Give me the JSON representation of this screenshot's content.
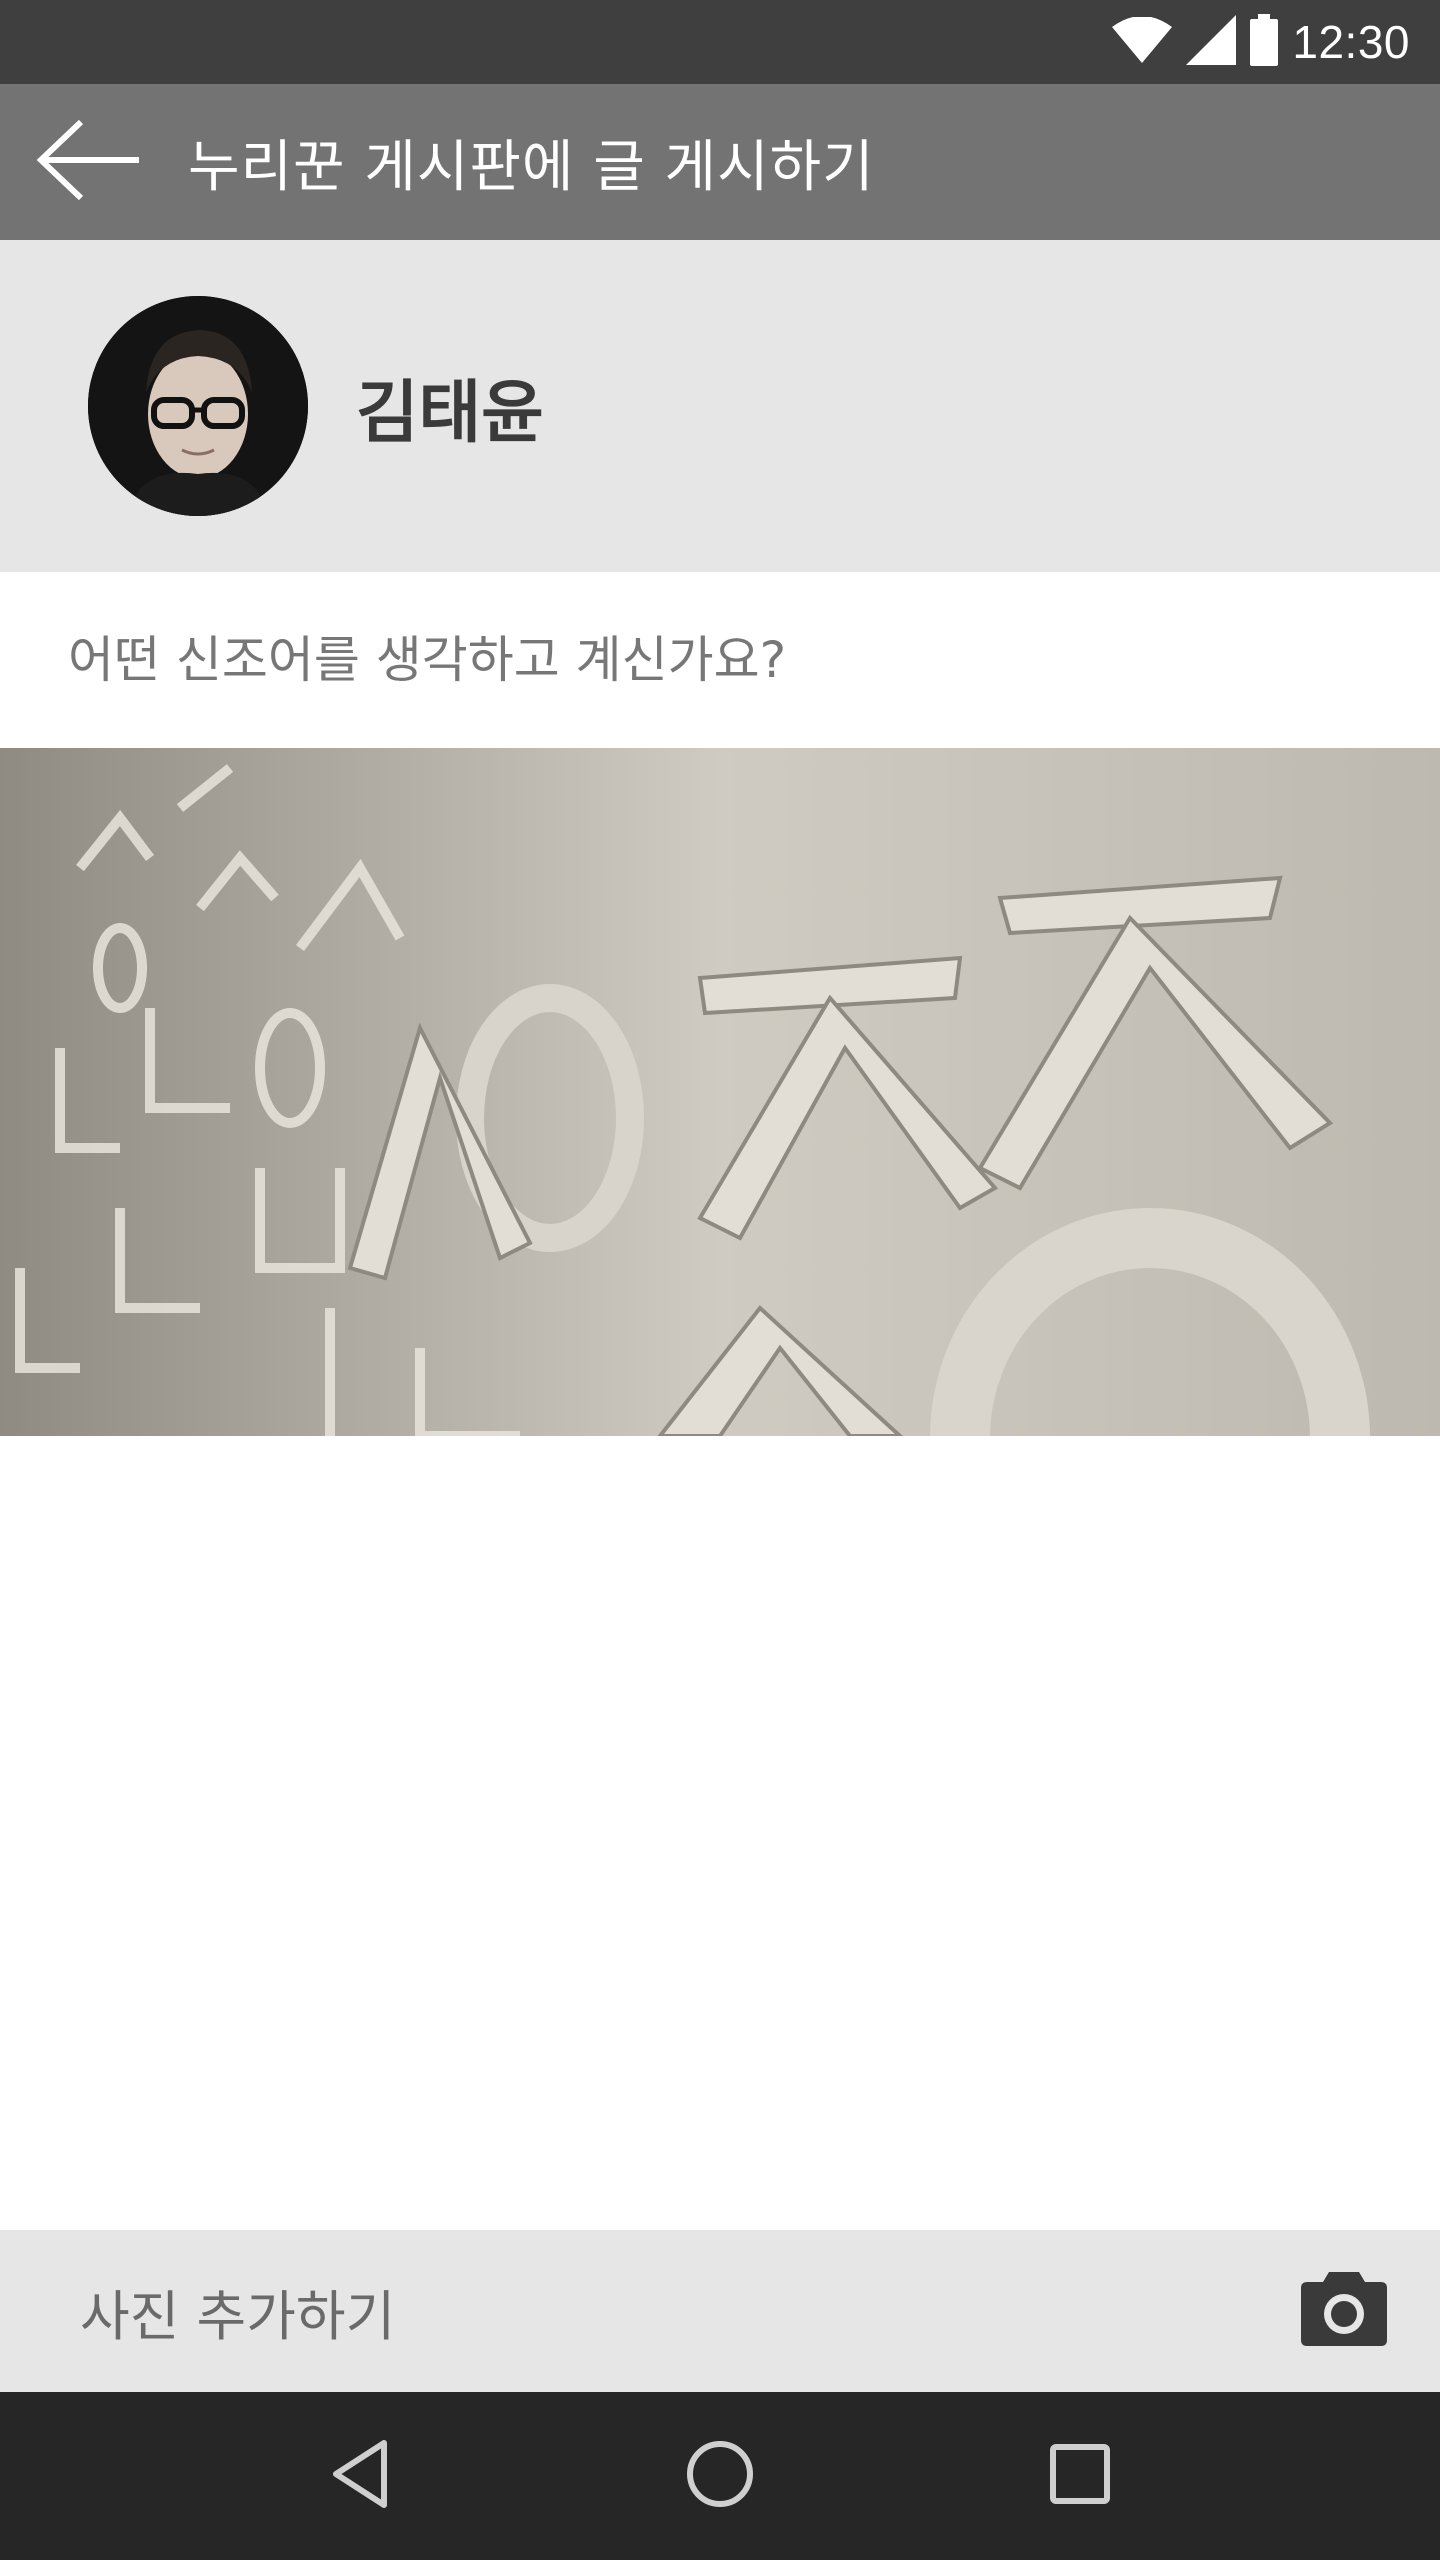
{
  "status_bar": {
    "time": "12:30",
    "icons": [
      "wifi-icon",
      "signal-icon",
      "battery-icon"
    ]
  },
  "app_bar": {
    "title": "누리꾼 게시판에 글 게시하기",
    "back_icon": "arrow-left-icon"
  },
  "profile": {
    "name": "김태윤"
  },
  "post": {
    "placeholder": "어떤 신조어를 생각하고 계신가요?"
  },
  "add_photo": {
    "label": "사진 추가하기",
    "icon": "camera-icon"
  },
  "nav_bar": {
    "icons": [
      "back-triangle-icon",
      "home-circle-icon",
      "recents-square-icon"
    ]
  },
  "colors": {
    "status_bar": "#3f3f3f",
    "app_bar": "#737373",
    "profile_bg": "#e6e6e6",
    "nav_bar": "#262626"
  }
}
